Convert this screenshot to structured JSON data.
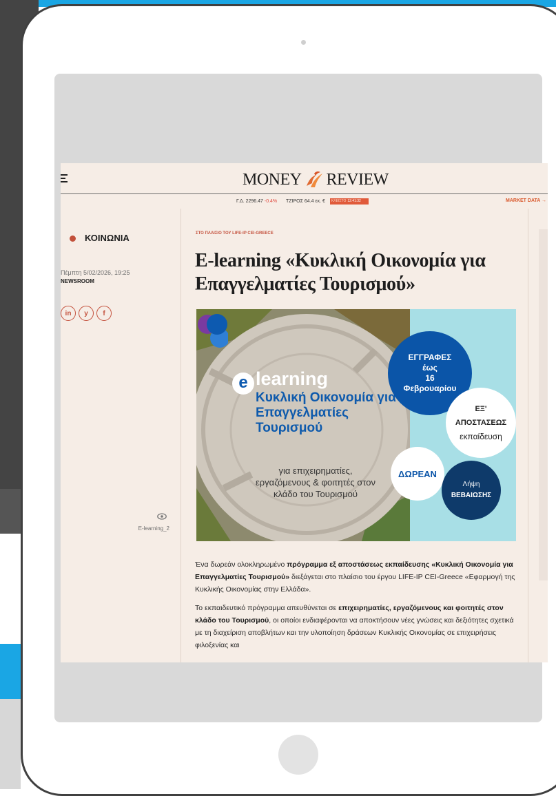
{
  "colors": {
    "accent": "#1aa6e4",
    "brand": "#c4523e",
    "cream": "#f6ede6"
  },
  "masthead": {
    "logo_left": "MONEY",
    "logo_right": "REVIEW",
    "menu_icon": "menu-icon"
  },
  "ticker": {
    "gd_label": "Γ.Δ.",
    "gd_value": "2296.47",
    "gd_change": "-0.4%",
    "turnover_label": "ΤΖΙΡΟΣ",
    "turnover_value": "64.4 εκ. €",
    "status_label": "ΚΛΕΙΣΤΟ",
    "status_time": "12:41:32",
    "market_data": "MARKET DATA →"
  },
  "article": {
    "section": "ΚΟΙΝΩΝΙΑ",
    "date": "Πέμπτη 5/02/2026, 19:25",
    "author": "NEWSROOM",
    "share": [
      "in",
      "y",
      "f"
    ],
    "kicker": "ΣΤΟ ΠΛΑΙΣΙΟ ΤΟΥ LIFE-IP CEI-GREECE",
    "title": "E-learning «Κυκλική Οικονομία για Επαγγελματίες Τουρισμού»",
    "image_caption": "E-learning_2",
    "image": {
      "word": "learning",
      "letter": "e",
      "headline": "Κυκλική Οικονομία για Επαγγελματίες Τουρισμού",
      "audience": "για επιχειρηματίες, εργαζόμενους & φοιτητές στον κλάδο του Τουρισμού",
      "registration": [
        "ΕΓΓΡΑΦΕΣ",
        "έως",
        "16",
        "Φεβρουαρίου"
      ],
      "distance": [
        "ΕΞ'",
        "ΑΠΟΣΤΑΣΕΩΣ",
        "εκπαίδευση"
      ],
      "free": "ΔΩΡΕΑΝ",
      "certificate": [
        "Λήψη",
        "ΒΕΒΑΙΩΣΗΣ"
      ]
    },
    "p1_a": "Ένα δωρεάν ολοκληρωμένο ",
    "p1_b": "πρόγραμμα εξ αποστάσεως εκπαίδευσης «Κυκλική Οικονομία για Επαγγελματίες Τουρισμού»",
    "p1_c": " διεξάγεται στο πλαίσιο του έργου LIFE-IP CEI-Greece «Εφαρμογή της Κυκλικής Οικονομίας στην Ελλάδα».",
    "p2_a": "Το εκπαιδευτικό πρόγραμμα απευθύνεται σε ",
    "p2_b": "επιχειρηματίες, εργαζόμενους και φοιτητές στον κλάδο του Τουρισμού",
    "p2_c": ", οι οποίοι ενδιαφέρονται να αποκτήσουν νέες γνώσεις και δεξιότητες σχετικά με τη διαχείριση αποβλήτων και την υλοποίηση δράσεων Κυκλικής Οικονομίας σε επιχειρήσεις φιλοξενίας και"
  }
}
